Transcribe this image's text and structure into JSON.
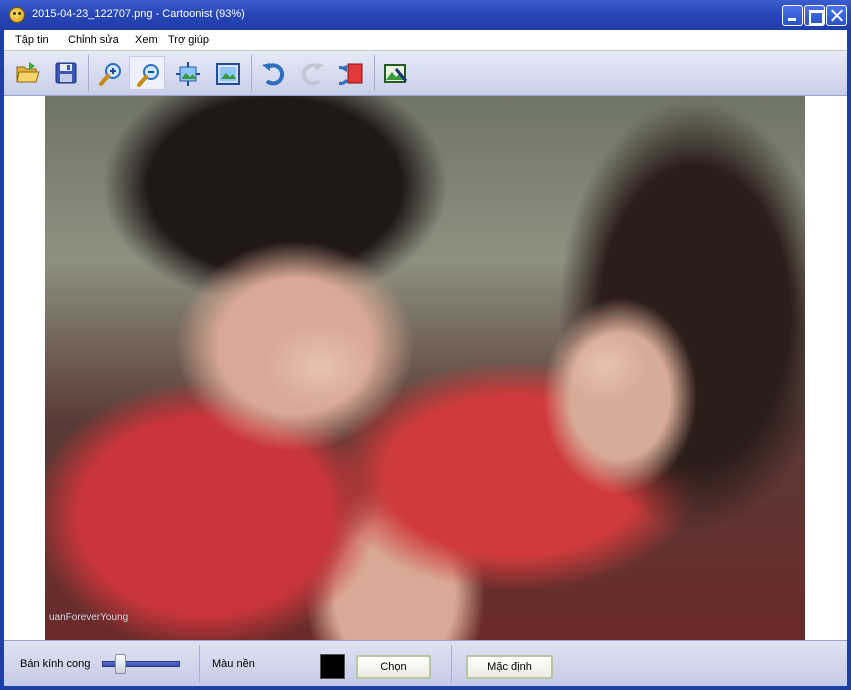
{
  "window": {
    "title": "2015-04-23_122707.png - Cartoonist (93%)"
  },
  "menu": {
    "items": [
      "Tập tin",
      "Chỉnh sửa",
      "Xem",
      "Trợ giúp"
    ]
  },
  "toolbar": {
    "buttons": [
      "open-folder-icon",
      "save-icon",
      "zoom-in-icon",
      "zoom-out-icon",
      "fit-to-window-icon",
      "actual-size-icon",
      "undo-icon",
      "redo-icon",
      "reset-icon",
      "export-image-icon"
    ],
    "active": "zoom-out-icon"
  },
  "photo": {
    "watermark": "uanForeverYoung"
  },
  "bottom_panel": {
    "curve_radius_label": "Bán kính cong",
    "curve_radius_value": 0.2,
    "background_color_label": "Màu nền",
    "background_color": "#000000",
    "choose_button": "Chọn",
    "default_button": "Mặc định"
  }
}
